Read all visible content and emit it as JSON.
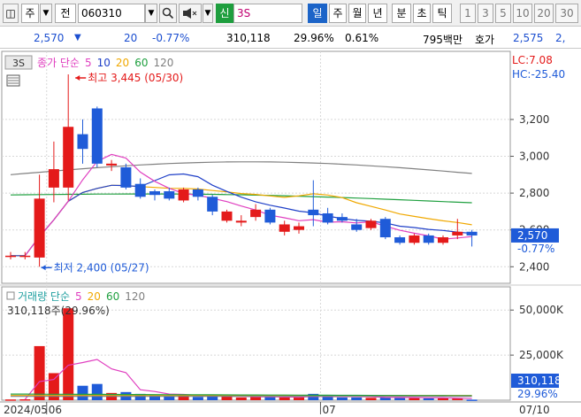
{
  "toolbar": {
    "type_label": "주",
    "jeon_label": "전",
    "code": "060310",
    "sin_label": "신",
    "name": "3S",
    "periods": [
      "일",
      "주",
      "월",
      "년",
      "분",
      "초",
      "틱"
    ],
    "selected_period": "일",
    "minutes": [
      "1",
      "3",
      "5",
      "10",
      "20",
      "30"
    ]
  },
  "info": {
    "price": "2,570",
    "change": "20",
    "change_pct": "-0.77%",
    "volume": "310,118",
    "pct2": "29.96%",
    "pct3": "0.61%",
    "amount": "795백만",
    "hoga_label": "호가",
    "hoga1": "2,575",
    "hoga2": "2,"
  },
  "colors": {
    "up": "#e41a1a",
    "down": "#1f5bd8",
    "ma5": "#e040c0",
    "ma10": "#2040c8",
    "ma20": "#f0a800",
    "ma60": "#20a040",
    "ma120": "#808080"
  },
  "price_panel": {
    "badge": "3S",
    "legend": [
      {
        "label": "종가 단순",
        "color": "#e040c0"
      },
      {
        "label": "5",
        "color": "#e040c0"
      },
      {
        "label": "10",
        "color": "#2040c8"
      },
      {
        "label": "20",
        "color": "#f0a800"
      },
      {
        "label": "60",
        "color": "#20a040"
      },
      {
        "label": "120",
        "color": "#808080"
      }
    ],
    "lc": "LC:7.08",
    "hc": "HC:-25.40",
    "high_note": "최고 3,445 (05/30)",
    "low_note": "최저 2,400 (05/27)",
    "last_price": "2,570",
    "last_pct": "-0.77%"
  },
  "volume_panel": {
    "legend": [
      {
        "label": "거래량 단순",
        "color": "#20a0a0"
      },
      {
        "label": "5",
        "color": "#e040c0"
      },
      {
        "label": "20",
        "color": "#f0a800"
      },
      {
        "label": "60",
        "color": "#20a040"
      },
      {
        "label": "120",
        "color": "#808080"
      }
    ],
    "value_note": "310,118주(29.96%)",
    "last_volume": "310,118",
    "last_pct": "29.96%"
  },
  "x_labels": [
    {
      "text": "2024/05",
      "idx": 0
    },
    {
      "text": "06",
      "idx": 3
    },
    {
      "text": "07",
      "idx": 22
    },
    {
      "text": "07/10",
      "idx": 31
    }
  ],
  "chart_data": {
    "type": "candlestick",
    "price_axis": {
      "ticks": [
        2400,
        2600,
        2800,
        3000,
        3200
      ],
      "labels": [
        "2,400",
        "2,600",
        "2,800",
        "3,000",
        "3,200"
      ],
      "ylim": [
        2310,
        3570
      ]
    },
    "volume_axis": {
      "ticks": [
        25000,
        50000
      ],
      "labels": [
        "25,000K",
        "50,000K"
      ],
      "ylim": [
        0,
        56000
      ]
    },
    "candles": [
      {
        "o": 2460,
        "h": 2480,
        "l": 2440,
        "c": 2460,
        "v": 400
      },
      {
        "o": 2460,
        "h": 2480,
        "l": 2440,
        "c": 2460,
        "v": 500
      },
      {
        "o": 2450,
        "h": 2900,
        "l": 2400,
        "c": 2770,
        "v": 30000
      },
      {
        "o": 2830,
        "h": 3080,
        "l": 2750,
        "c": 2930,
        "v": 15000
      },
      {
        "o": 2830,
        "h": 3445,
        "l": 2760,
        "c": 3160,
        "v": 51000
      },
      {
        "o": 3120,
        "h": 3200,
        "l": 2960,
        "c": 3040,
        "v": 8000
      },
      {
        "o": 3260,
        "h": 3270,
        "l": 2940,
        "c": 2960,
        "v": 9000
      },
      {
        "o": 2950,
        "h": 2980,
        "l": 2920,
        "c": 2960,
        "v": 4000
      },
      {
        "o": 2940,
        "h": 2960,
        "l": 2820,
        "c": 2830,
        "v": 4500
      },
      {
        "o": 2850,
        "h": 2880,
        "l": 2770,
        "c": 2780,
        "v": 3500
      },
      {
        "o": 2810,
        "h": 2820,
        "l": 2760,
        "c": 2790,
        "v": 3000
      },
      {
        "o": 2810,
        "h": 2830,
        "l": 2760,
        "c": 2770,
        "v": 2000
      },
      {
        "o": 2760,
        "h": 2830,
        "l": 2750,
        "c": 2820,
        "v": 3000
      },
      {
        "o": 2820,
        "h": 2830,
        "l": 2760,
        "c": 2780,
        "v": 1800
      },
      {
        "o": 2780,
        "h": 2790,
        "l": 2680,
        "c": 2700,
        "v": 2000
      },
      {
        "o": 2650,
        "h": 2710,
        "l": 2640,
        "c": 2700,
        "v": 2200
      },
      {
        "o": 2640,
        "h": 2680,
        "l": 2620,
        "c": 2650,
        "v": 1500
      },
      {
        "o": 2670,
        "h": 2740,
        "l": 2650,
        "c": 2710,
        "v": 2000
      },
      {
        "o": 2710,
        "h": 2720,
        "l": 2630,
        "c": 2640,
        "v": 1700
      },
      {
        "o": 2590,
        "h": 2650,
        "l": 2570,
        "c": 2630,
        "v": 1500
      },
      {
        "o": 2600,
        "h": 2640,
        "l": 2580,
        "c": 2620,
        "v": 1500
      },
      {
        "o": 2710,
        "h": 2870,
        "l": 2620,
        "c": 2680,
        "v": 3500
      },
      {
        "o": 2690,
        "h": 2720,
        "l": 2630,
        "c": 2640,
        "v": 1800
      },
      {
        "o": 2670,
        "h": 2690,
        "l": 2640,
        "c": 2650,
        "v": 1500
      },
      {
        "o": 2630,
        "h": 2660,
        "l": 2590,
        "c": 2600,
        "v": 1500
      },
      {
        "o": 2610,
        "h": 2660,
        "l": 2600,
        "c": 2650,
        "v": 1300
      },
      {
        "o": 2660,
        "h": 2670,
        "l": 2550,
        "c": 2560,
        "v": 1600
      },
      {
        "o": 2560,
        "h": 2570,
        "l": 2520,
        "c": 2530,
        "v": 1500
      },
      {
        "o": 2530,
        "h": 2580,
        "l": 2520,
        "c": 2570,
        "v": 1200
      },
      {
        "o": 2570,
        "h": 2580,
        "l": 2520,
        "c": 2530,
        "v": 1000
      },
      {
        "o": 2530,
        "h": 2570,
        "l": 2520,
        "c": 2560,
        "v": 1000
      },
      {
        "o": 2570,
        "h": 2660,
        "l": 2550,
        "c": 2590,
        "v": 900
      },
      {
        "o": 2590,
        "h": 2600,
        "l": 2510,
        "c": 2570,
        "v": 310
      }
    ]
  }
}
